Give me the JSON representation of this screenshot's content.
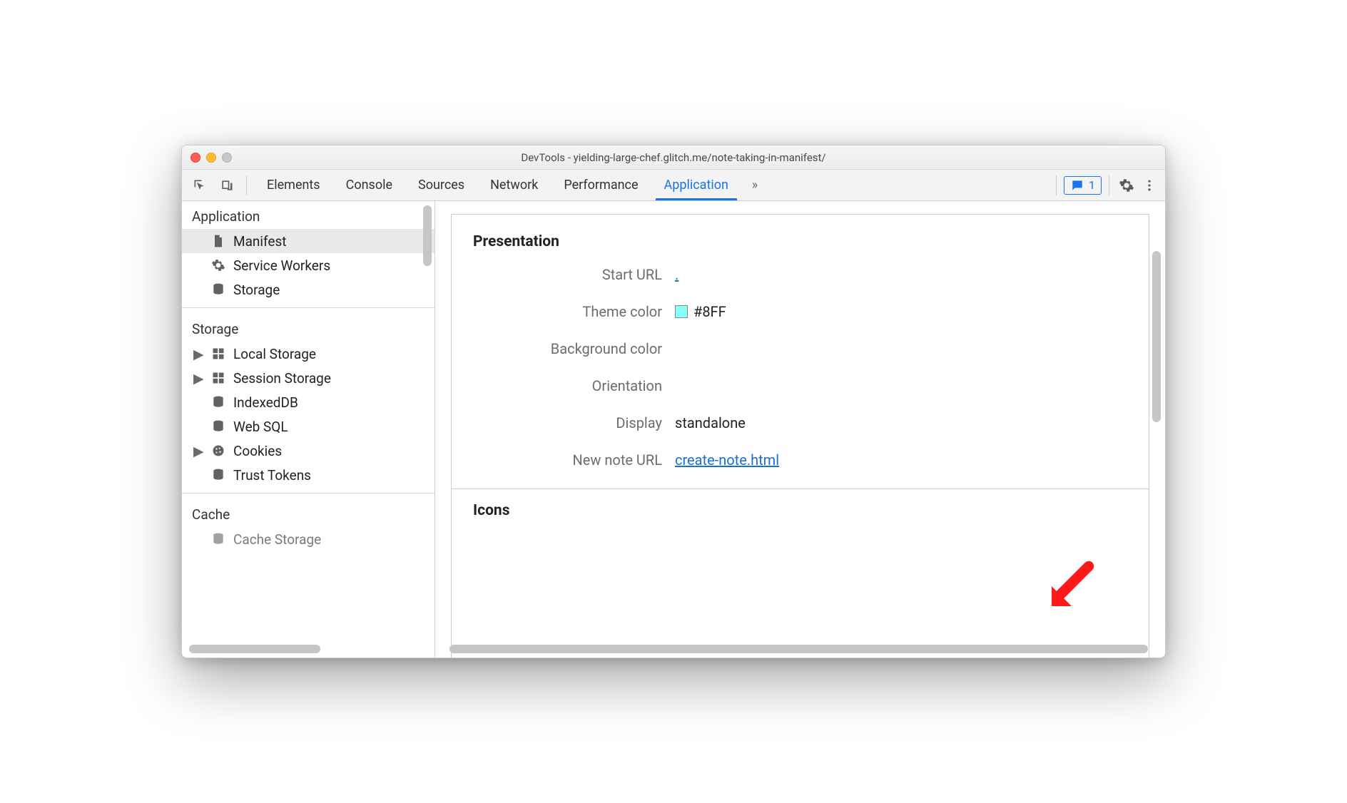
{
  "window": {
    "title": "DevTools - yielding-large-chef.glitch.me/note-taking-in-manifest/"
  },
  "toolbar": {
    "tabs": [
      "Elements",
      "Console",
      "Sources",
      "Network",
      "Performance",
      "Application"
    ],
    "active_tab": "Application",
    "more_glyph": "»",
    "errors_count": "1"
  },
  "sidebar": {
    "groups": [
      {
        "label": "Application",
        "items": [
          {
            "icon": "document",
            "label": "Manifest",
            "selected": true,
            "expandable": false
          },
          {
            "icon": "gear",
            "label": "Service Workers",
            "selected": false,
            "expandable": false
          },
          {
            "icon": "db",
            "label": "Storage",
            "selected": false,
            "expandable": false
          }
        ]
      },
      {
        "label": "Storage",
        "items": [
          {
            "icon": "grid",
            "label": "Local Storage",
            "selected": false,
            "expandable": true
          },
          {
            "icon": "grid",
            "label": "Session Storage",
            "selected": false,
            "expandable": true
          },
          {
            "icon": "db",
            "label": "IndexedDB",
            "selected": false,
            "expandable": false
          },
          {
            "icon": "db",
            "label": "Web SQL",
            "selected": false,
            "expandable": false
          },
          {
            "icon": "cookie",
            "label": "Cookies",
            "selected": false,
            "expandable": true
          },
          {
            "icon": "db",
            "label": "Trust Tokens",
            "selected": false,
            "expandable": false
          }
        ]
      },
      {
        "label": "Cache",
        "items": [
          {
            "icon": "db",
            "label": "Cache Storage",
            "selected": false,
            "expandable": false
          }
        ]
      }
    ]
  },
  "manifest": {
    "section": "Presentation",
    "fields": {
      "start_url": {
        "label": "Start URL",
        "value": "."
      },
      "theme_color": {
        "label": "Theme color",
        "value": "#8FF",
        "swatch": "#88ffff"
      },
      "background_color": {
        "label": "Background color",
        "value": ""
      },
      "orientation": {
        "label": "Orientation",
        "value": ""
      },
      "display": {
        "label": "Display",
        "value": "standalone"
      },
      "new_note_url": {
        "label": "New note URL",
        "value": "create-note.html"
      }
    },
    "icons_section": "Icons"
  }
}
